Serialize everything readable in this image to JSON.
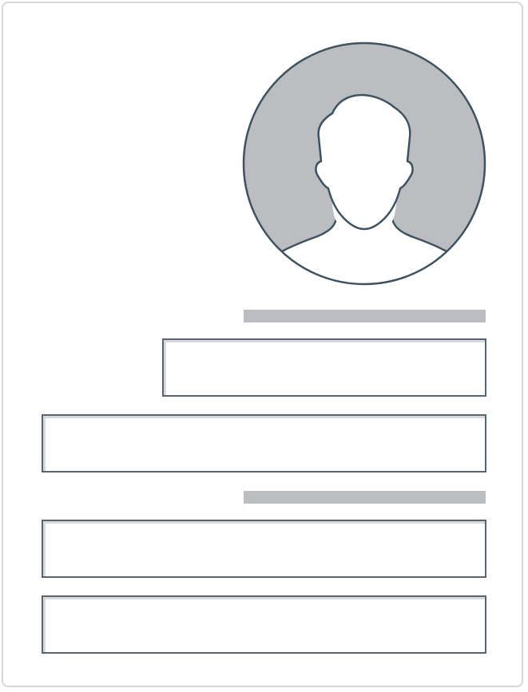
{
  "profile": {
    "avatar_icon": "user-silhouette-icon",
    "colors": {
      "avatar_fill": "#bcbdc0",
      "outline": "#3f5260",
      "placeholder_bar": "#bcbdc0",
      "field_border": "#56656f",
      "card_border": "#d6d7d9"
    }
  },
  "section_1": {
    "label": "",
    "field_short": {
      "value": "",
      "placeholder": ""
    },
    "field_wide": {
      "value": "",
      "placeholder": ""
    }
  },
  "section_2": {
    "label": "",
    "field_1": {
      "value": "",
      "placeholder": ""
    },
    "field_2": {
      "value": "",
      "placeholder": ""
    }
  }
}
